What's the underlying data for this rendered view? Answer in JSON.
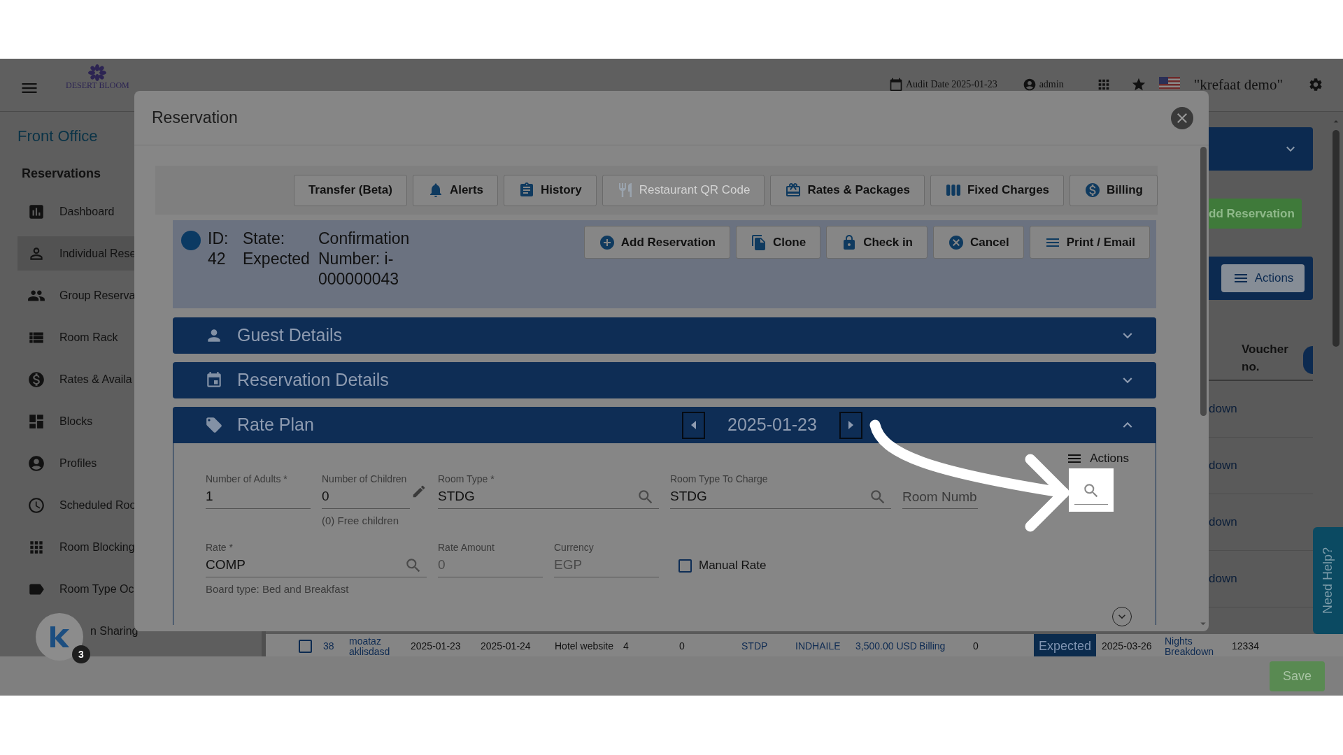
{
  "topbar": {
    "logo": "DESERT BLOOM",
    "audit_date": "Audit Date 2025-01-23",
    "user": "admin",
    "property": "\"krefaat demo\""
  },
  "sidebar": {
    "module": "Front Office",
    "section": "Reservations",
    "items": [
      {
        "label": "Dashboard",
        "selected": false
      },
      {
        "label": "Individual Rese",
        "selected": true
      },
      {
        "label": "Group Reserva",
        "selected": false
      },
      {
        "label": "Room Rack",
        "selected": false
      },
      {
        "label": "Rates & Availa",
        "selected": false
      },
      {
        "label": "Blocks",
        "selected": false
      },
      {
        "label": "Profiles",
        "selected": false
      },
      {
        "label": "Scheduled Roo",
        "selected": false
      },
      {
        "label": "Room Blocking",
        "selected": false
      },
      {
        "label": "Room Type Oc",
        "selected": false
      },
      {
        "label": "n Sharing",
        "selected": false
      }
    ],
    "assistant_badge": "3"
  },
  "background": {
    "add_button": "dd Reservation",
    "actions_button": "Actions",
    "column_header": "Voucher no.",
    "column_cells": [
      "down",
      "down",
      "down",
      "down"
    ],
    "row": {
      "checked": false,
      "status": "Expected",
      "cells": [
        {
          "text": "38",
          "link": true
        },
        {
          "text": "moataz aklisdasd",
          "link": true
        },
        {
          "text": "2025-01-23",
          "link": false
        },
        {
          "text": "2025-01-24",
          "link": false
        },
        {
          "text": "Hotel website",
          "link": false
        },
        {
          "text": "4",
          "link": false
        },
        {
          "text": "0",
          "link": false
        },
        {
          "text": "STDP",
          "link": true
        },
        {
          "text": "INDHAILE",
          "link": true
        },
        {
          "text": "3,500.00 USD",
          "link": true
        },
        {
          "text": "Billing",
          "link": true
        },
        {
          "text": "0",
          "link": false
        },
        {
          "text": "2025-03-26",
          "link": false
        },
        {
          "text": "Nights Breakdown",
          "link": true
        },
        {
          "text": "12334",
          "link": false
        }
      ]
    },
    "save_button": "Save",
    "help_tab": "Need Help?"
  },
  "modal": {
    "title": "Reservation",
    "toolbar": [
      {
        "label": "Transfer (Beta)",
        "disabled": false
      },
      {
        "label": "Alerts",
        "disabled": false
      },
      {
        "label": "History",
        "disabled": false
      },
      {
        "label": "Restaurant QR Code",
        "disabled": true
      },
      {
        "label": "Rates & Packages",
        "disabled": false
      },
      {
        "label": "Fixed Charges",
        "disabled": false
      },
      {
        "label": "Billing",
        "disabled": false
      }
    ],
    "info": {
      "id": "ID: 42",
      "state": "State: Expected",
      "confirmation": "Confirmation Number: i-000000043"
    },
    "actions": [
      "Add Reservation",
      "Clone",
      "Check in",
      "Cancel",
      "Print / Email"
    ],
    "sections": [
      {
        "title": "Guest Details",
        "expanded": false
      },
      {
        "title": "Reservation Details",
        "expanded": false
      },
      {
        "title": "Rate Plan",
        "expanded": true,
        "date": "2025-01-23"
      }
    ],
    "rate_plan": {
      "actions_label": "Actions",
      "row_1": [
        {
          "kind": "text",
          "label": "Number of Adults *",
          "value": "1",
          "disabled": false
        },
        {
          "kind": "edit",
          "label": "Number of Children",
          "value": "0",
          "hint": "(0) Free children",
          "disabled": false
        },
        {
          "kind": "search",
          "label": "Room Type *",
          "value": "STDG",
          "disabled": false
        },
        {
          "kind": "search",
          "label": "Room Type To Charge",
          "value": "STDG",
          "disabled": false
        },
        {
          "kind": "placeholder",
          "placeholder": "Room Numb"
        }
      ],
      "row_2": [
        {
          "kind": "search",
          "label": "Rate *",
          "value": "COMP",
          "hint": "Board type: Bed and Breakfast",
          "disabled": false
        },
        {
          "kind": "text",
          "label": "Rate Amount",
          "value": "0",
          "disabled": true
        },
        {
          "kind": "text",
          "label": "Currency",
          "value": "EGP",
          "disabled": true
        },
        {
          "kind": "checkbox",
          "label": "Manual Rate",
          "checked": false
        }
      ]
    }
  }
}
